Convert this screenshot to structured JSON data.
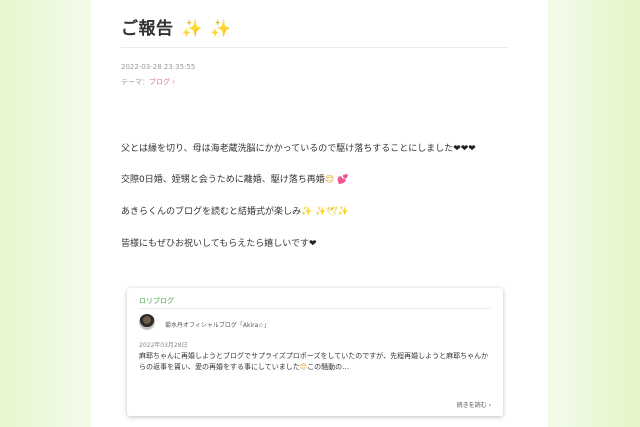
{
  "post": {
    "title": "ご報告",
    "title_emoji": "✨ ✨",
    "datetime": "2022-03-28 23:35:55",
    "theme_prefix": "テーマ：",
    "theme_link": "ブログ",
    "theme_chevron": "›"
  },
  "body": {
    "line1_text": "父とは縁を切り、母は海老蔵洗脳にかかっているので駆け落ちすることにしました",
    "line1_emoji": "❤❤❤",
    "line2_text": "交際0日婚、姪甥と会うために離婚、駆け落ち再婚",
    "line2_emoji1": "😊",
    "line2_emoji2": "💕",
    "line3_text": "あきらくんのブログを読むと結婚式が楽しみ",
    "line3_emoji": "✨ ✨🕊✨",
    "line4_text": "皆様にもぜひお祝いしてもらえたら嬉しいです",
    "line4_emoji": "❤"
  },
  "card": {
    "label": "ロリブログ",
    "blog_name": "菊水丹オフィシャルブログ「Akira☆」",
    "date": "2022年03月28日",
    "excerpt_1": "麻耶ちゃんに再婚しようとブログでサプライズプロポーズをしていたのですが、先程再婚しようと麻耶ちゃんからの返事を貰い、愛の再婚をする事にしていました",
    "excerpt_emoji": "😊",
    "excerpt_2": "この騒動の…",
    "read_more": "続きを読む",
    "read_more_chevron": "›"
  }
}
